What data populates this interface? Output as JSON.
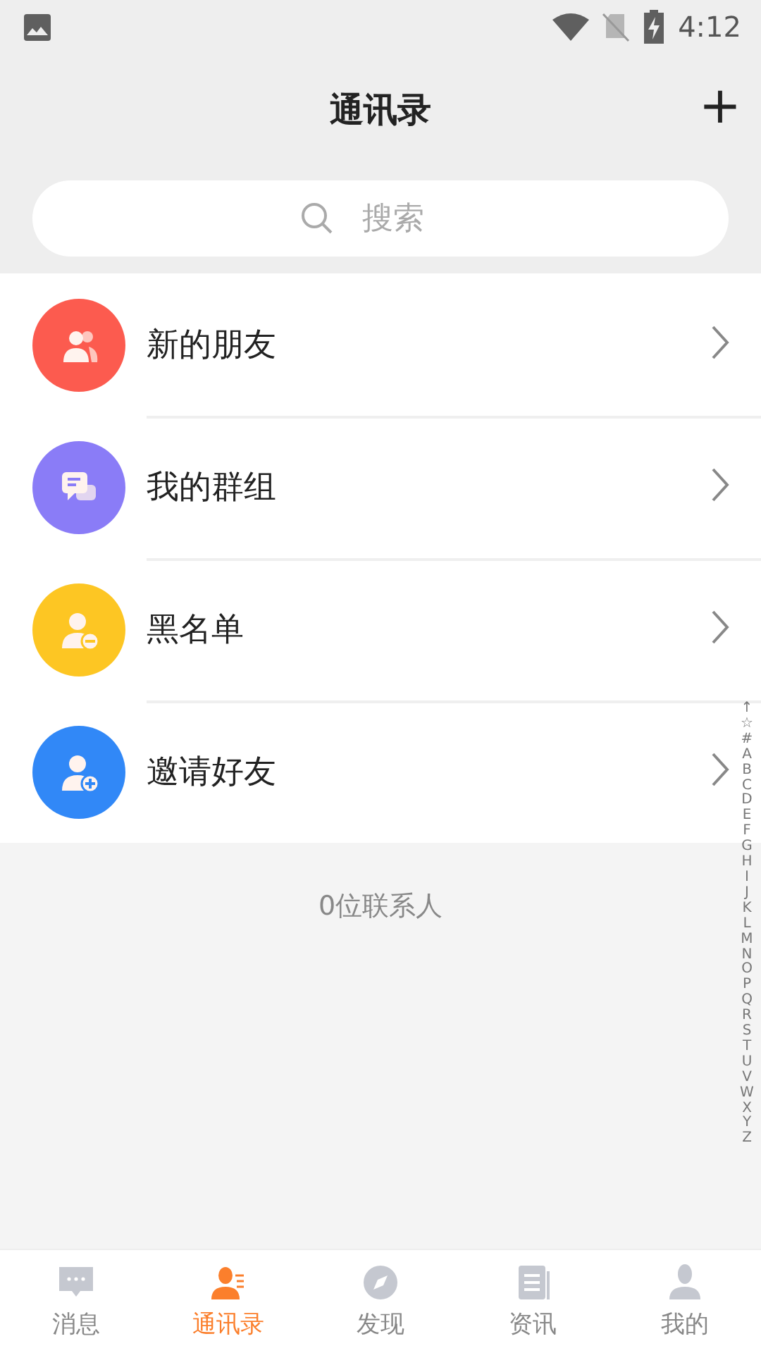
{
  "status_bar": {
    "time": "4:12"
  },
  "header": {
    "title": "通讯录",
    "add_icon": "+"
  },
  "search": {
    "placeholder": "搜索"
  },
  "menu": [
    {
      "label": "新的朋友",
      "kind": "friends",
      "color": "#fc5b4f"
    },
    {
      "label": "我的群组",
      "kind": "groups",
      "color": "#8a7cf7"
    },
    {
      "label": "黑名单",
      "kind": "blocked",
      "color": "#fdc623"
    },
    {
      "label": "邀请好友",
      "kind": "invite",
      "color": "#3188f7"
    }
  ],
  "contact_count": "0位联系人",
  "index": [
    "↑",
    "☆",
    "#",
    "A",
    "B",
    "C",
    "D",
    "E",
    "F",
    "G",
    "H",
    "I",
    "J",
    "K",
    "L",
    "M",
    "N",
    "O",
    "P",
    "Q",
    "R",
    "S",
    "T",
    "U",
    "V",
    "W",
    "X",
    "Y",
    "Z"
  ],
  "tabs": [
    {
      "label": "消息",
      "kind": "chat",
      "selected": false
    },
    {
      "label": "通讯录",
      "kind": "contacts",
      "selected": true
    },
    {
      "label": "发现",
      "kind": "compass",
      "selected": false
    },
    {
      "label": "资讯",
      "kind": "news",
      "selected": false
    },
    {
      "label": "我的",
      "kind": "me",
      "selected": false
    }
  ]
}
